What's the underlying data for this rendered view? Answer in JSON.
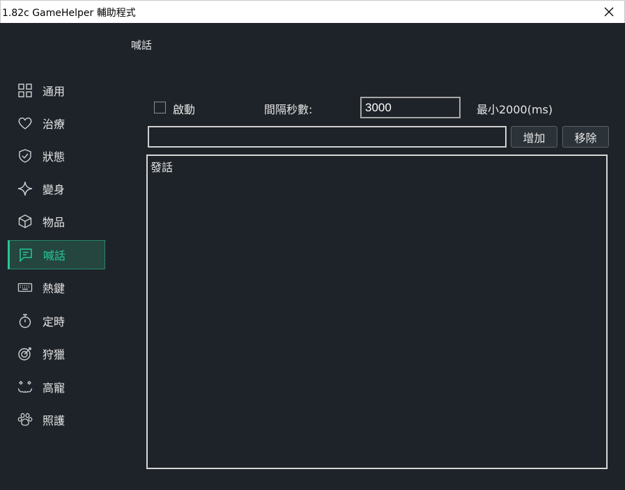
{
  "window": {
    "title": "1.82c GameHelper 輔助程式"
  },
  "page": {
    "title": "喊話"
  },
  "sidebar": {
    "items": [
      {
        "label": "通用",
        "icon": "grid-icon"
      },
      {
        "label": "治療",
        "icon": "heart-icon"
      },
      {
        "label": "狀態",
        "icon": "shield-icon"
      },
      {
        "label": "變身",
        "icon": "sparkle-icon"
      },
      {
        "label": "物品",
        "icon": "cube-icon"
      },
      {
        "label": "喊話",
        "icon": "chat-icon",
        "active": true
      },
      {
        "label": "熱鍵",
        "icon": "keyboard-icon"
      },
      {
        "label": "定時",
        "icon": "timer-icon"
      },
      {
        "label": "狩獵",
        "icon": "target-icon"
      },
      {
        "label": "高寵",
        "icon": "pet-face-icon"
      },
      {
        "label": "照護",
        "icon": "paw-icon"
      }
    ]
  },
  "form": {
    "enable_label": "啟動",
    "interval_label": "間隔秒數:",
    "interval_value": "3000",
    "min_label": "最小2000(ms)",
    "message_value": "",
    "add_label": "增加",
    "remove_label": "移除"
  },
  "list": {
    "header": "發話"
  },
  "colors": {
    "background": "#1e2329",
    "accent": "#27c79b",
    "active_bg": "#24463e"
  }
}
